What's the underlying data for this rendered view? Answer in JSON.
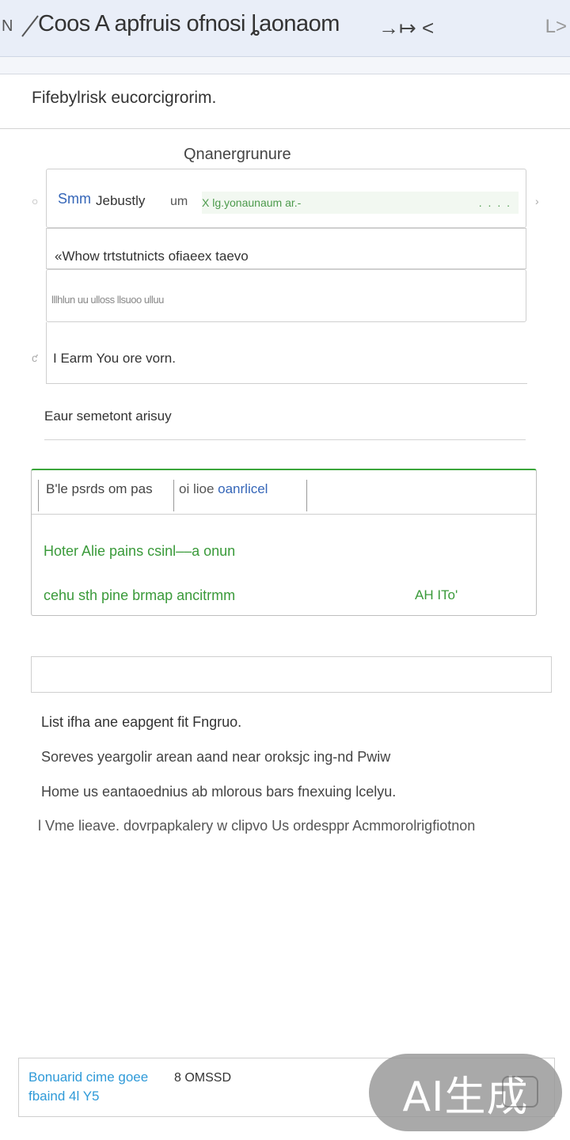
{
  "topbar": {
    "left_mark": "N",
    "title": "Coos A apfruis ofnosi ȴaonaom",
    "nav_arrows": "→↦ <",
    "right_btn": "L>"
  },
  "subheader": "Fifebylrisk eucorcigrorim.",
  "section_title": "Qnanergrunure",
  "rows": {
    "row1": {
      "label_a": "Smm",
      "label_b": "Jebustly",
      "label_c": "um",
      "green_text": "X lg.yonaunaum ar.-",
      "dots": ". . . ."
    },
    "row2": "«Whow trtstutnicts ofiaeex taevo",
    "row3": "lllhlun uu ulloss llsuoo ulluu",
    "row4": "I Earm You ore vorn."
  },
  "side_glyphs": {
    "left1": "○",
    "right1": "›",
    "left4": "ƈ"
  },
  "summary": "Eaur semetont arisuy",
  "panel": {
    "tab_a": "B'le psrds om pas",
    "tab_b_prefix": "oi lioe ",
    "tab_b_highlight": "oanrlicel",
    "line1": "Hoter Alie pains csinl––a onun",
    "line2": "cehu sth pine brmap ancitrmm",
    "line2b": "AH ITo'",
    "accent_color": "#3aa63a"
  },
  "input_box_value": "",
  "paragraphs": [
    "List ifha ane eapgent fit Fngruo.",
    "Soreves yeargolir arean aand near oroksjc ing-nd Pwiw",
    "Home us eantaoednius ab mlorous bars fnexuing lcelyu.",
    "l Vme lieave. dovrpapkalery w clipvo Us ordesppr Acmmorolrigfiotnon"
  ],
  "bottom": {
    "line1": "Bonuarid cime goee",
    "line1b": "8 OMSSD",
    "line2": "fbaind 4l Y5"
  },
  "badge": {
    "text": "AI生成"
  }
}
